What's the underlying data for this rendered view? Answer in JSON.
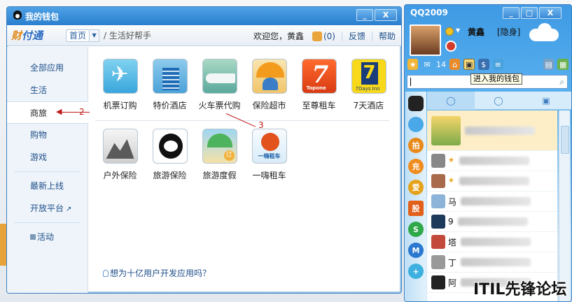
{
  "wallet": {
    "title": "我的钱包",
    "logo": {
      "part1": "财",
      "part2": "付通"
    },
    "breadcrumb": {
      "home": "首页",
      "current": "/ 生活好帮手"
    },
    "welcome": "欢迎您，黄鑫",
    "messages": "(0)",
    "feedback": "反馈",
    "help": "帮助",
    "sidebar": {
      "items": [
        {
          "label": "全部应用"
        },
        {
          "label": "生活"
        },
        {
          "label": "商旅"
        },
        {
          "label": "购物"
        },
        {
          "label": "游戏"
        },
        {
          "label": "最新上线"
        },
        {
          "label": "开放平台"
        },
        {
          "label": "活动"
        }
      ],
      "active_index": 2
    },
    "apps_row1": [
      {
        "label": "机票订购",
        "icon": "airplane-icon"
      },
      {
        "label": "特价酒店",
        "icon": "hotel-icon"
      },
      {
        "label": "火车票代购",
        "icon": "train-icon"
      },
      {
        "label": "保险超市",
        "icon": "insurance-icon"
      },
      {
        "label": "至尊租车",
        "icon": "topone-icon"
      },
      {
        "label": "7天酒店",
        "icon": "7days-icon"
      }
    ],
    "apps_row2": [
      {
        "label": "户外保险",
        "icon": "outdoor-icon"
      },
      {
        "label": "旅游保险",
        "icon": "panda-icon"
      },
      {
        "label": "旅游度假",
        "icon": "beach-icon"
      },
      {
        "label": "一嗨租车",
        "icon": "ehi-icon"
      }
    ],
    "promo": "想为十亿用户开发应用吗？",
    "controls": {
      "minimize": "_",
      "close": "X"
    }
  },
  "annotations": {
    "one": "1",
    "two": "2",
    "three": "3"
  },
  "qq": {
    "title": "QQ2009",
    "user": "黄鑫",
    "status": "[隐身]",
    "mail_count": "14",
    "tooltip": "进入我的钱包",
    "left_icons": [
      "拍",
      "充",
      "爱",
      "股",
      "S",
      "M",
      "+"
    ],
    "friends": [
      {
        "name": ""
      },
      {
        "name": ""
      },
      {
        "name": ""
      },
      {
        "name": "马"
      },
      {
        "name": "9"
      },
      {
        "name": "塔"
      },
      {
        "name": "丁"
      },
      {
        "name": "阿"
      }
    ],
    "controls": {
      "minimize": "_",
      "maximize": "□",
      "close": "X"
    }
  },
  "watermark": "ITIL先锋论坛",
  "colors": {
    "title_blue": "#2a7fcf",
    "link_blue": "#1f4f8a",
    "annotation_red": "#c21a1a"
  }
}
